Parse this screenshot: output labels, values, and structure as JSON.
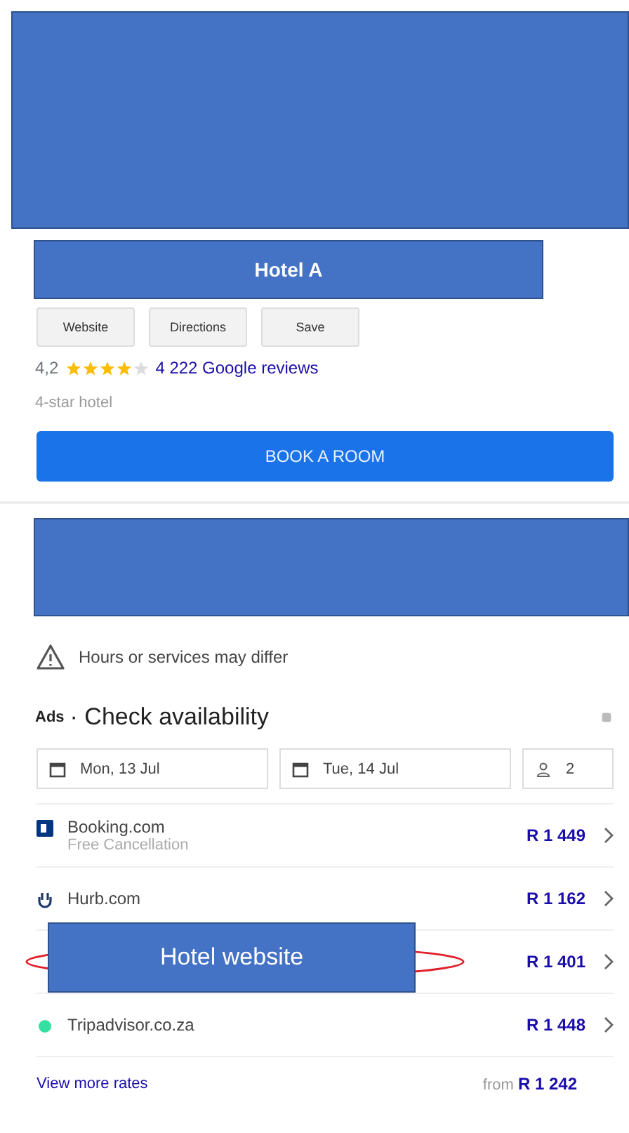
{
  "cover_top": {
    "kind": "redaction"
  },
  "hotel": {
    "name_label": "Hotel A",
    "actions": [
      "Website",
      "Directions",
      "Save"
    ],
    "rating": "4,2",
    "stars": 4,
    "reviews": "4 222 Google reviews",
    "category": "4-star hotel",
    "book_button": "BOOK A ROOM"
  },
  "cover_middle": {
    "kind": "redaction"
  },
  "notice": "Hours or services may differ",
  "availability": {
    "ads": "Ads",
    "title": "· Check availability",
    "check_in": "Mon, 13 Jul",
    "check_out": "Tue, 14 Jul",
    "guests": "2"
  },
  "offers": [
    {
      "kind": "square",
      "name": "Booking.com",
      "note": "Free Cancellation",
      "price": "R 1 449"
    },
    {
      "kind": "hurb",
      "name": "Hurb.com",
      "price": "R 1 162"
    },
    {
      "kind": "hidden",
      "price": "R 1 401",
      "cover_label": "Hotel website",
      "circled": true
    },
    {
      "kind": "dot",
      "color": "#34e0a1",
      "name": "Tripadvisor.co.za",
      "price": "R 1 448"
    }
  ],
  "footer": {
    "link": "View more rates",
    "from": "from",
    "price": "R 1 242"
  }
}
